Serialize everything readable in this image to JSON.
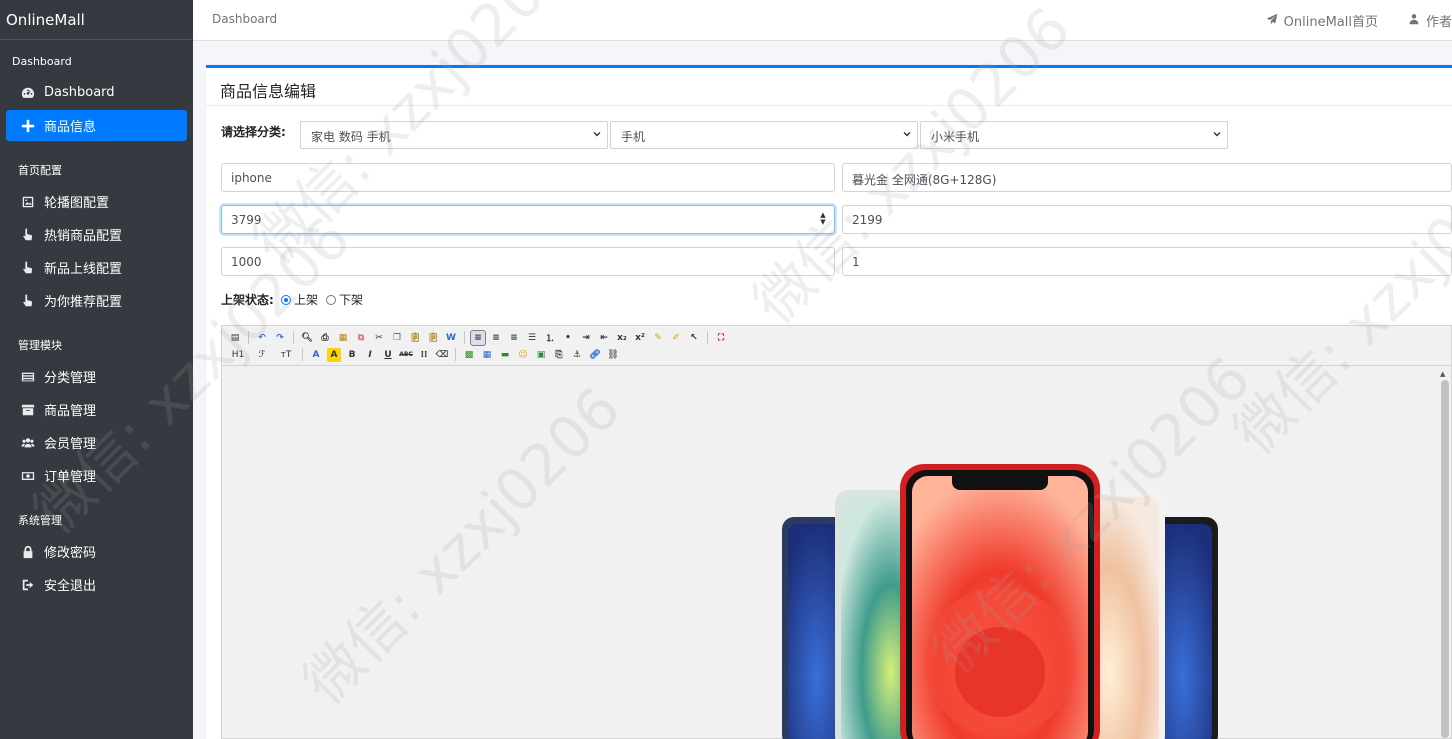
{
  "brand": "OnlineMall",
  "sidebar": {
    "groups": [
      {
        "header": "Dashboard",
        "items": [
          {
            "label": "Dashboard",
            "icon": "dashboard-icon"
          },
          {
            "label": "商品信息",
            "icon": "plus-icon",
            "active": true
          }
        ]
      },
      {
        "header": "首页配置",
        "items": [
          {
            "label": "轮播图配置",
            "icon": "image-icon"
          },
          {
            "label": "热销商品配置",
            "icon": "hand-pointer-icon"
          },
          {
            "label": "新品上线配置",
            "icon": "hand-pointer-icon"
          },
          {
            "label": "为你推荐配置",
            "icon": "hand-pointer-icon"
          }
        ]
      },
      {
        "header": "管理模块",
        "items": [
          {
            "label": "分类管理",
            "icon": "list-icon"
          },
          {
            "label": "商品管理",
            "icon": "archive-icon"
          },
          {
            "label": "会员管理",
            "icon": "users-icon"
          },
          {
            "label": "订单管理",
            "icon": "money-icon"
          }
        ]
      },
      {
        "header": "系统管理",
        "items": [
          {
            "label": "修改密码",
            "icon": "lock-icon"
          },
          {
            "label": "安全退出",
            "icon": "sign-out-icon"
          }
        ]
      }
    ]
  },
  "topbar": {
    "breadcrumb": "Dashboard",
    "home_link": "OnlineMall首页",
    "author_link": "作者"
  },
  "card": {
    "title": "商品信息编辑",
    "category_label": "请选择分类:",
    "category_level1": "家电 数码 手机",
    "category_level2": "手机",
    "category_level3": "小米手机",
    "goods_name": "iphone",
    "goods_intro": "暮光金 全网通(8G+128G)",
    "original_price": "3799",
    "selling_price": "2199",
    "stock": "1000",
    "tag": "1",
    "status_label": "上架状态:",
    "status_on": "上架",
    "status_off": "下架",
    "status_selected": "上架"
  },
  "editor": {
    "toolbar_row2_text": {
      "heading": "H1",
      "font": "ℱ",
      "size": "тT",
      "bold": "B",
      "italic": "I",
      "underline": "U",
      "strike": "ABC"
    }
  },
  "watermark": "微信: xzxj0206",
  "colors": {
    "sidebar_bg": "#343a40",
    "accent": "#007bff"
  }
}
